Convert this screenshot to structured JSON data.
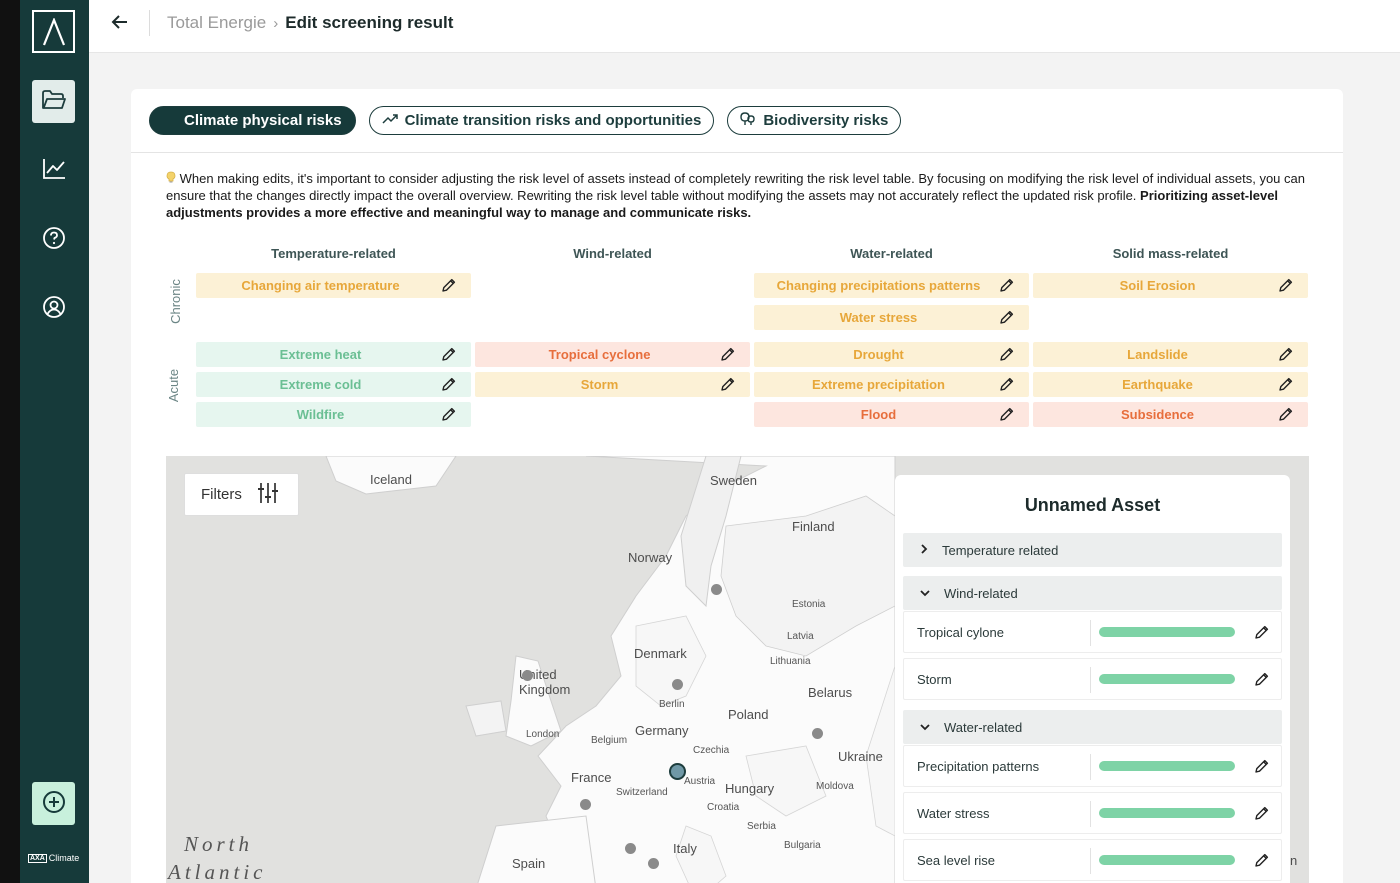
{
  "app": {
    "brand_text": "Climate",
    "brand_mark": "AXA",
    "nav_icons": [
      "folder-icon",
      "chart-icon",
      "help-icon",
      "account-icon",
      "add-icon"
    ]
  },
  "header": {
    "breadcrumb_parent": "Total Energie",
    "breadcrumb_separator": "›",
    "page_title": "Edit screening result"
  },
  "tabs": [
    {
      "label": "Climate physical risks",
      "active": true
    },
    {
      "label": "Climate transition risks and opportunities",
      "active": false
    },
    {
      "label": "Biodiversity risks",
      "active": false
    }
  ],
  "tip": {
    "icon": "lightbulb-icon",
    "text": "When making edits, it's important to consider adjusting the risk level of assets instead of completely rewriting the risk level table. By focusing on modifying the risk level of individual assets, you can ensure that the changes directly impact the overall overview. Rewriting the risk level table without modifying the assets may not accurately reflect the updated risk profile. ",
    "bold_text": "Prioritizing asset-level adjustments provides a more effective and meaningful way to manage and communicate risks."
  },
  "matrix": {
    "columns": [
      "Temperature-related",
      "Wind-related",
      "Water-related",
      "Solid mass-related"
    ],
    "rows": [
      "Chronic",
      "Acute"
    ],
    "chronic": [
      {
        "label": "Changing air temperature",
        "level": "yellow"
      },
      {
        "label": "Changing precipitations patterns",
        "level": "yellow"
      },
      {
        "label": "Water stress",
        "level": "yellow"
      },
      {
        "label": "Soil Erosion",
        "level": "yellow"
      }
    ],
    "acute": [
      {
        "label": "Extreme heat",
        "level": "green"
      },
      {
        "label": "Extreme cold",
        "level": "green"
      },
      {
        "label": "Wildfire",
        "level": "green"
      },
      {
        "label": "Tropical cyclone",
        "level": "red"
      },
      {
        "label": "Storm",
        "level": "yellow"
      },
      {
        "label": "Drought",
        "level": "yellow"
      },
      {
        "label": "Extreme precipitation",
        "level": "yellow"
      },
      {
        "label": "Flood",
        "level": "red"
      },
      {
        "label": "Landslide",
        "level": "yellow"
      },
      {
        "label": "Earthquake",
        "level": "yellow"
      },
      {
        "label": "Subsidence",
        "level": "red"
      }
    ],
    "colors": {
      "green": "#6bbf94",
      "yellow": "#e7a73a",
      "red": "#e76e3c"
    }
  },
  "map": {
    "filters_label": "Filters",
    "labels": [
      "Iceland",
      "Sweden",
      "Finland",
      "Norway",
      "Estonia",
      "Latvia",
      "Lithuania",
      "Denmark",
      "United Kingdom",
      "Belarus",
      "Berlin",
      "Poland",
      "London",
      "Germany",
      "Belgium",
      "Czechia",
      "Ukraine",
      "France",
      "Austria",
      "Hungary",
      "Moldova",
      "Switzerland",
      "Croatia",
      "Serbia",
      "Bulgaria",
      "Italy",
      "Spain",
      "North",
      "Atlantic",
      "n"
    ]
  },
  "asset_panel": {
    "title": "Unnamed Asset",
    "groups": [
      {
        "label": "Temperature related",
        "expanded": false
      },
      {
        "label": "Wind-related",
        "expanded": true
      },
      {
        "label": "Water-related",
        "expanded": true
      }
    ],
    "items": [
      {
        "label": "Tropical cylone",
        "level": 1.0
      },
      {
        "label": "Storm",
        "level": 1.0
      },
      {
        "label": "Precipitation patterns",
        "level": 1.0
      },
      {
        "label": "Water stress",
        "level": 1.0
      },
      {
        "label": "Sea level rise",
        "level": 1.0
      }
    ],
    "bar_color": "#7ed3a6"
  }
}
